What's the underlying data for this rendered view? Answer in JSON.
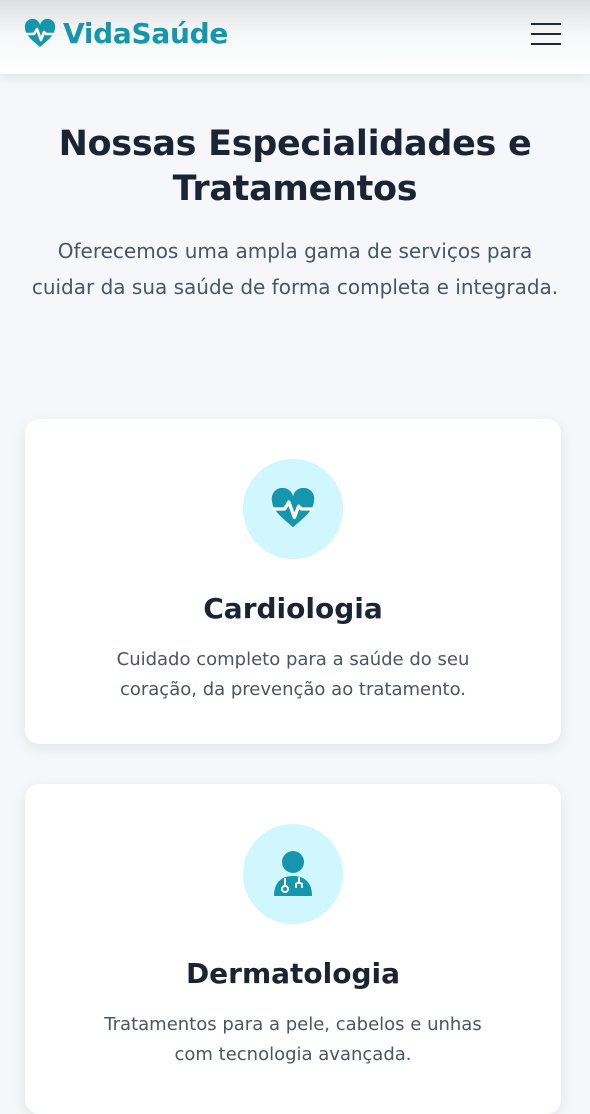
{
  "header": {
    "brand": "VidaSaúde",
    "logo_icon": "heart-pulse-icon",
    "menu_icon": "hamburger-menu-icon"
  },
  "section": {
    "title": "Nossas Especialidades e Tratamentos",
    "subtitle": "Oferecemos uma ampla gama de serviços para cuidar da sua saúde de forma completa e integrada."
  },
  "cards": [
    {
      "icon": "heart-pulse-icon",
      "title": "Cardiologia",
      "description": "Cuidado completo para a saúde do seu coração, da prevenção ao tratamento."
    },
    {
      "icon": "doctor-icon",
      "title": "Dermatologia",
      "description": "Tratamentos para a pele, cabelos e unhas com tecnologia avançada."
    }
  ],
  "colors": {
    "brand": "#1496ad",
    "icon_bg": "#cff7fd",
    "heading": "#1c2434",
    "body_text": "#4b5563",
    "page_bg": "#f5f7fa"
  }
}
